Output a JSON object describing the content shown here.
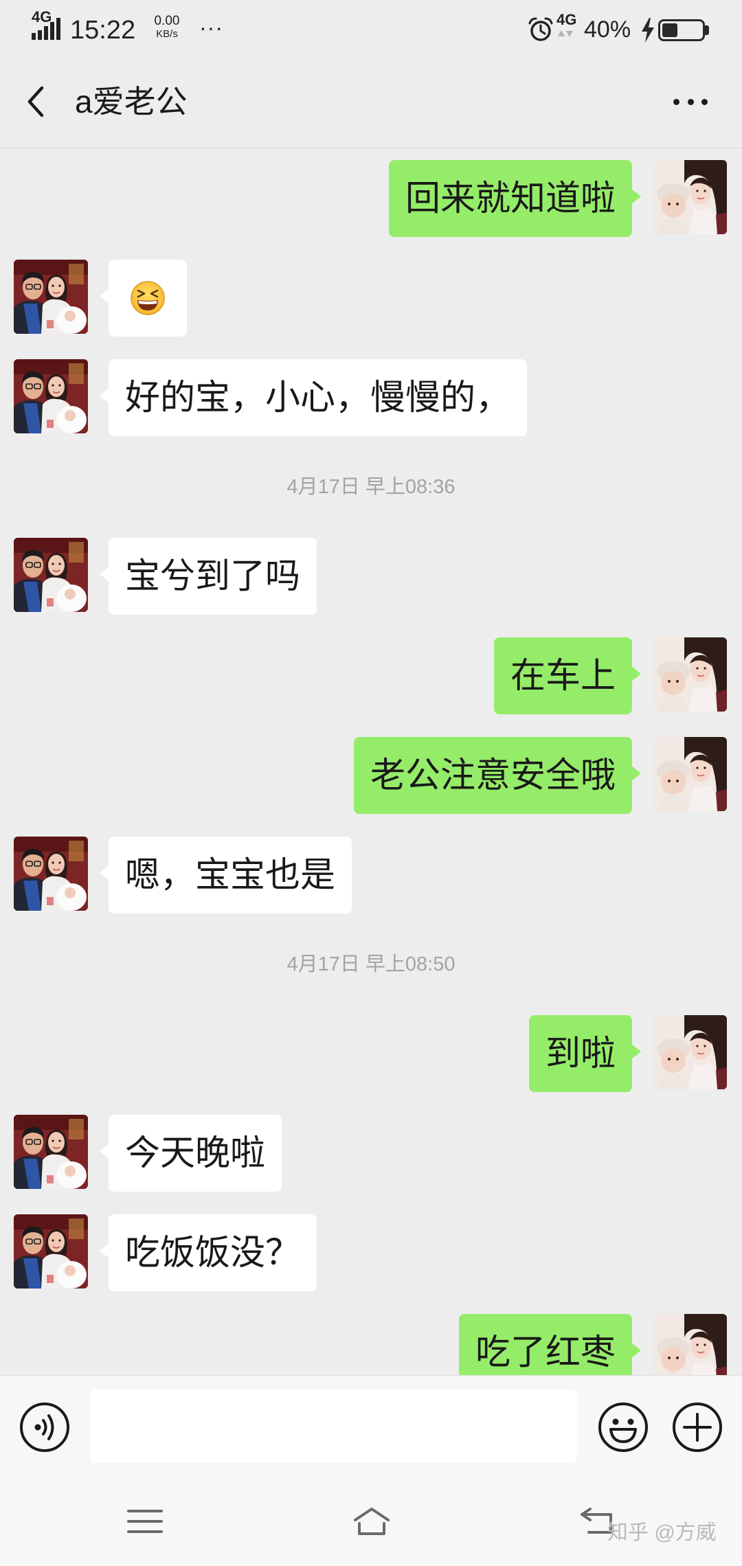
{
  "colors": {
    "chat_background": "#ededed",
    "sent_bubble": "#95ec69",
    "received_bubble": "#ffffff",
    "timestamp_text": "#a3a3a3"
  },
  "status_bar": {
    "network_left": "4G",
    "time": "15:22",
    "speed_value": "0.00",
    "speed_unit": "KB/s",
    "overflow_dots": "···",
    "alarm_icon": "alarm-clock-icon",
    "network_right": "4G",
    "battery_text": "40%",
    "battery_level": 0.4,
    "charging_icon": "lightning-bolt-icon"
  },
  "header": {
    "back_icon": "chevron-left-icon",
    "title": "a爱老公",
    "more_icon": "more-horizontal-icon"
  },
  "chat": [
    {
      "text": "回来就知道啦"
    },
    {
      "emoji_icon": "grinning-squinting-face-icon"
    },
    {
      "text": "好的宝，小心，慢慢的，"
    },
    {
      "time": "4月17日 早上08:36"
    },
    {
      "text": "宝兮到了吗"
    },
    {
      "text": "在车上"
    },
    {
      "text": "老公注意安全哦"
    },
    {
      "text": "嗯，宝宝也是"
    },
    {
      "time": "4月17日 早上08:50"
    },
    {
      "text": "到啦"
    },
    {
      "text": "今天晚啦"
    },
    {
      "text": "吃饭饭没？"
    },
    {
      "text": "吃了红枣"
    }
  ],
  "input_bar": {
    "message_value": "",
    "voice_icon": "voice-input-icon",
    "emoji_icon": "smiley-icon",
    "more_icon": "plus-circle-icon"
  },
  "nav_bar": {
    "menu_icon": "menu-icon",
    "home_icon": "home-icon",
    "back_icon": "back-icon"
  },
  "watermark": "知乎 @方威"
}
